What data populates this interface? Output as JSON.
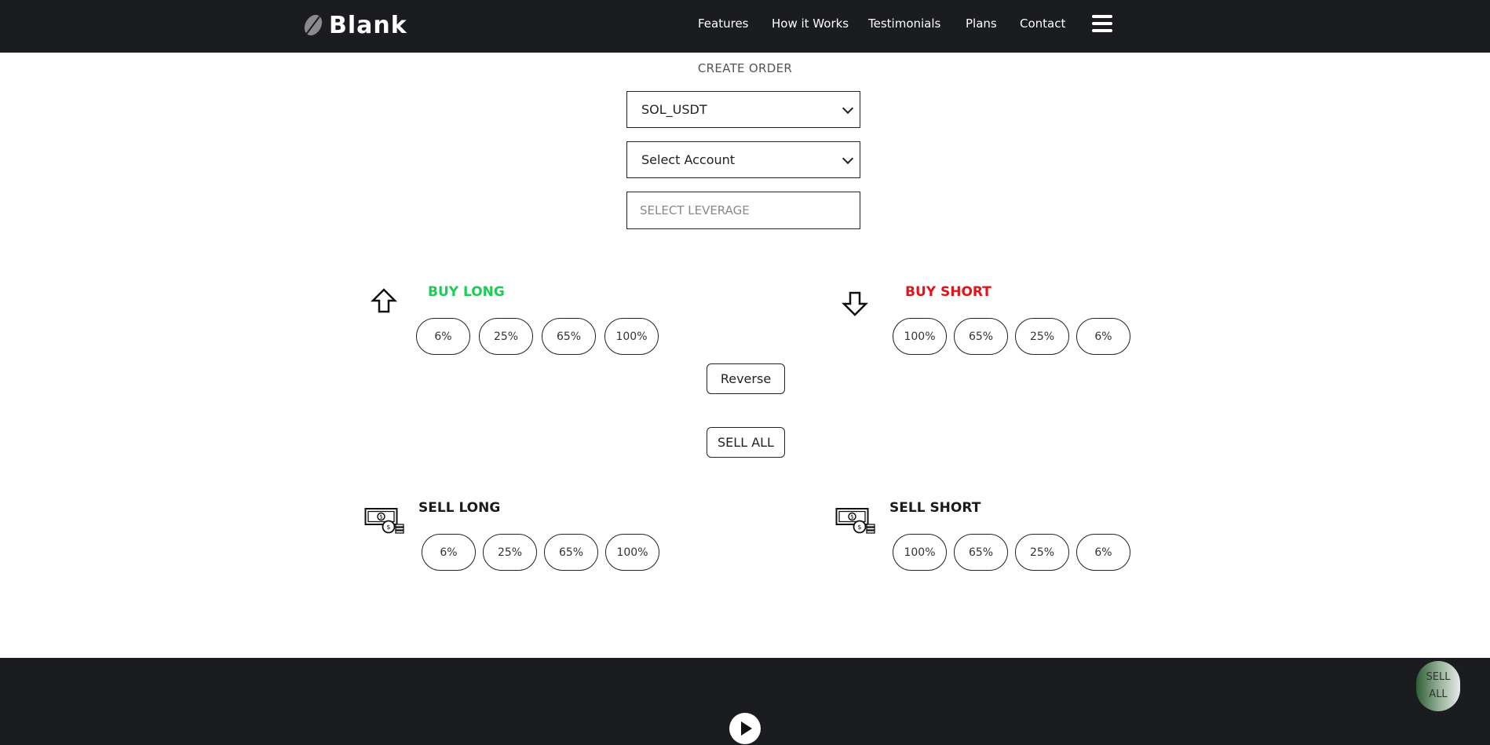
{
  "nav": {
    "brand": "Blank",
    "links": [
      "Features",
      "How it Works",
      "Testimonials",
      "Plans",
      "Contact"
    ]
  },
  "order": {
    "title": "CREATE ORDER",
    "symbol_value": "SOL_USDT",
    "account_value": "Select Account",
    "leverage_placeholder": "SELECT LEVERAGE"
  },
  "buy_long": {
    "title": "BUY LONG",
    "buttons": [
      "6%",
      "25%",
      "65%",
      "100%"
    ],
    "color": "#1ecb56"
  },
  "buy_short": {
    "title": "BUY SHORT",
    "buttons": [
      "100%",
      "65%",
      "25%",
      "6%"
    ],
    "color": "#e0141a"
  },
  "reverse_label": "Reverse",
  "sell_all_label": "SELL ALL",
  "sell_long": {
    "title": "SELL LONG",
    "buttons": [
      "6%",
      "25%",
      "65%",
      "100%"
    ]
  },
  "sell_short": {
    "title": "SELL SHORT",
    "buttons": [
      "100%",
      "65%",
      "25%",
      "6%"
    ]
  },
  "float_sell_all": {
    "line1": "SELL",
    "line2": "ALL"
  },
  "icons": {
    "brand": "leaf-logo-icon",
    "menu": "hamburger-menu-icon",
    "buy_long": "arrow-up-icon",
    "buy_short": "arrow-down-icon",
    "sell": "money-bill-icon",
    "play": "play-icon"
  }
}
